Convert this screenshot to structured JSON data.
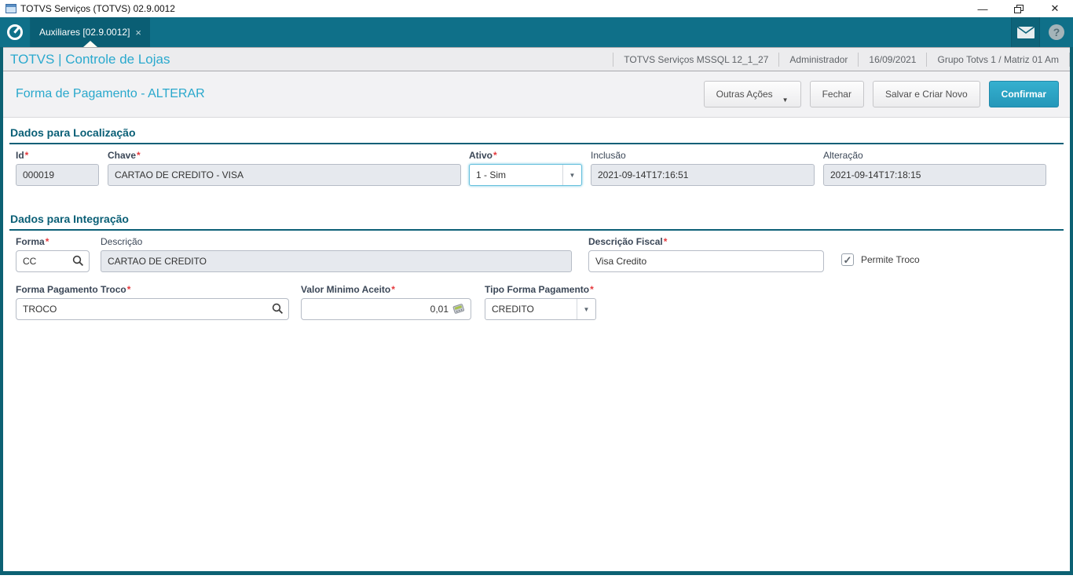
{
  "window": {
    "title": "TOTVS Serviços (TOTVS) 02.9.0012"
  },
  "icons": {
    "minimize": "—",
    "close_window": "✕",
    "tab_close": "×",
    "help": "?",
    "dropdown_arrow": "▼",
    "checkmark": "✓",
    "required": "*"
  },
  "tabbar": {
    "tab_label": "Auxiliares [02.9.0012]"
  },
  "header": {
    "brand": "TOTVS | Controle de Lojas",
    "env_items": [
      "TOTVS Serviços MSSQL 12_1_27",
      "Administrador",
      "16/09/2021",
      "Grupo Totvs 1 / Matriz 01 Am"
    ]
  },
  "toolbar": {
    "page_title": "Forma de Pagamento - ALTERAR",
    "outras_acoes": "Outras Ações",
    "fechar": "Fechar",
    "salvar_criar_novo": "Salvar e Criar Novo",
    "confirmar": "Confirmar"
  },
  "sections": {
    "localizacao": {
      "title": "Dados para Localização",
      "fields": {
        "id": {
          "label": "Id",
          "value": "000019"
        },
        "chave": {
          "label": "Chave",
          "value": "CARTAO DE CREDITO - VISA"
        },
        "ativo": {
          "label": "Ativo",
          "value": "1 - Sim"
        },
        "inclusao": {
          "label": "Inclusão",
          "value": "2021-09-14T17:16:51"
        },
        "alteracao": {
          "label": "Alteração",
          "value": "2021-09-14T17:18:15"
        }
      }
    },
    "integracao": {
      "title": "Dados para Integração",
      "fields": {
        "forma": {
          "label": "Forma",
          "value": "CC"
        },
        "descricao": {
          "label": "Descrição",
          "value": "CARTAO DE CREDITO"
        },
        "descricao_fiscal": {
          "label": "Descrição Fiscal",
          "value": "Visa Credito"
        },
        "permite_troco": {
          "label": "Permite Troco",
          "checked": true
        },
        "forma_pagamento_troco": {
          "label": "Forma Pagamento Troco",
          "value": "TROCO"
        },
        "valor_minimo": {
          "label": "Valor Minimo Aceito",
          "value": "0,01"
        },
        "tipo_forma_pagamento": {
          "label": "Tipo Forma Pagamento",
          "value": "CREDITO"
        }
      }
    }
  },
  "colors": {
    "teal_bar": "#0f7089",
    "teal_dark": "#0a5e74",
    "frame_border": "#0c6173",
    "accent_cyan": "#29a8cc",
    "section_title": "#0a5f76",
    "primary_button": "#2ba3c4",
    "required_red": "#e5393d",
    "readonly_field": "#e6e9ee"
  }
}
